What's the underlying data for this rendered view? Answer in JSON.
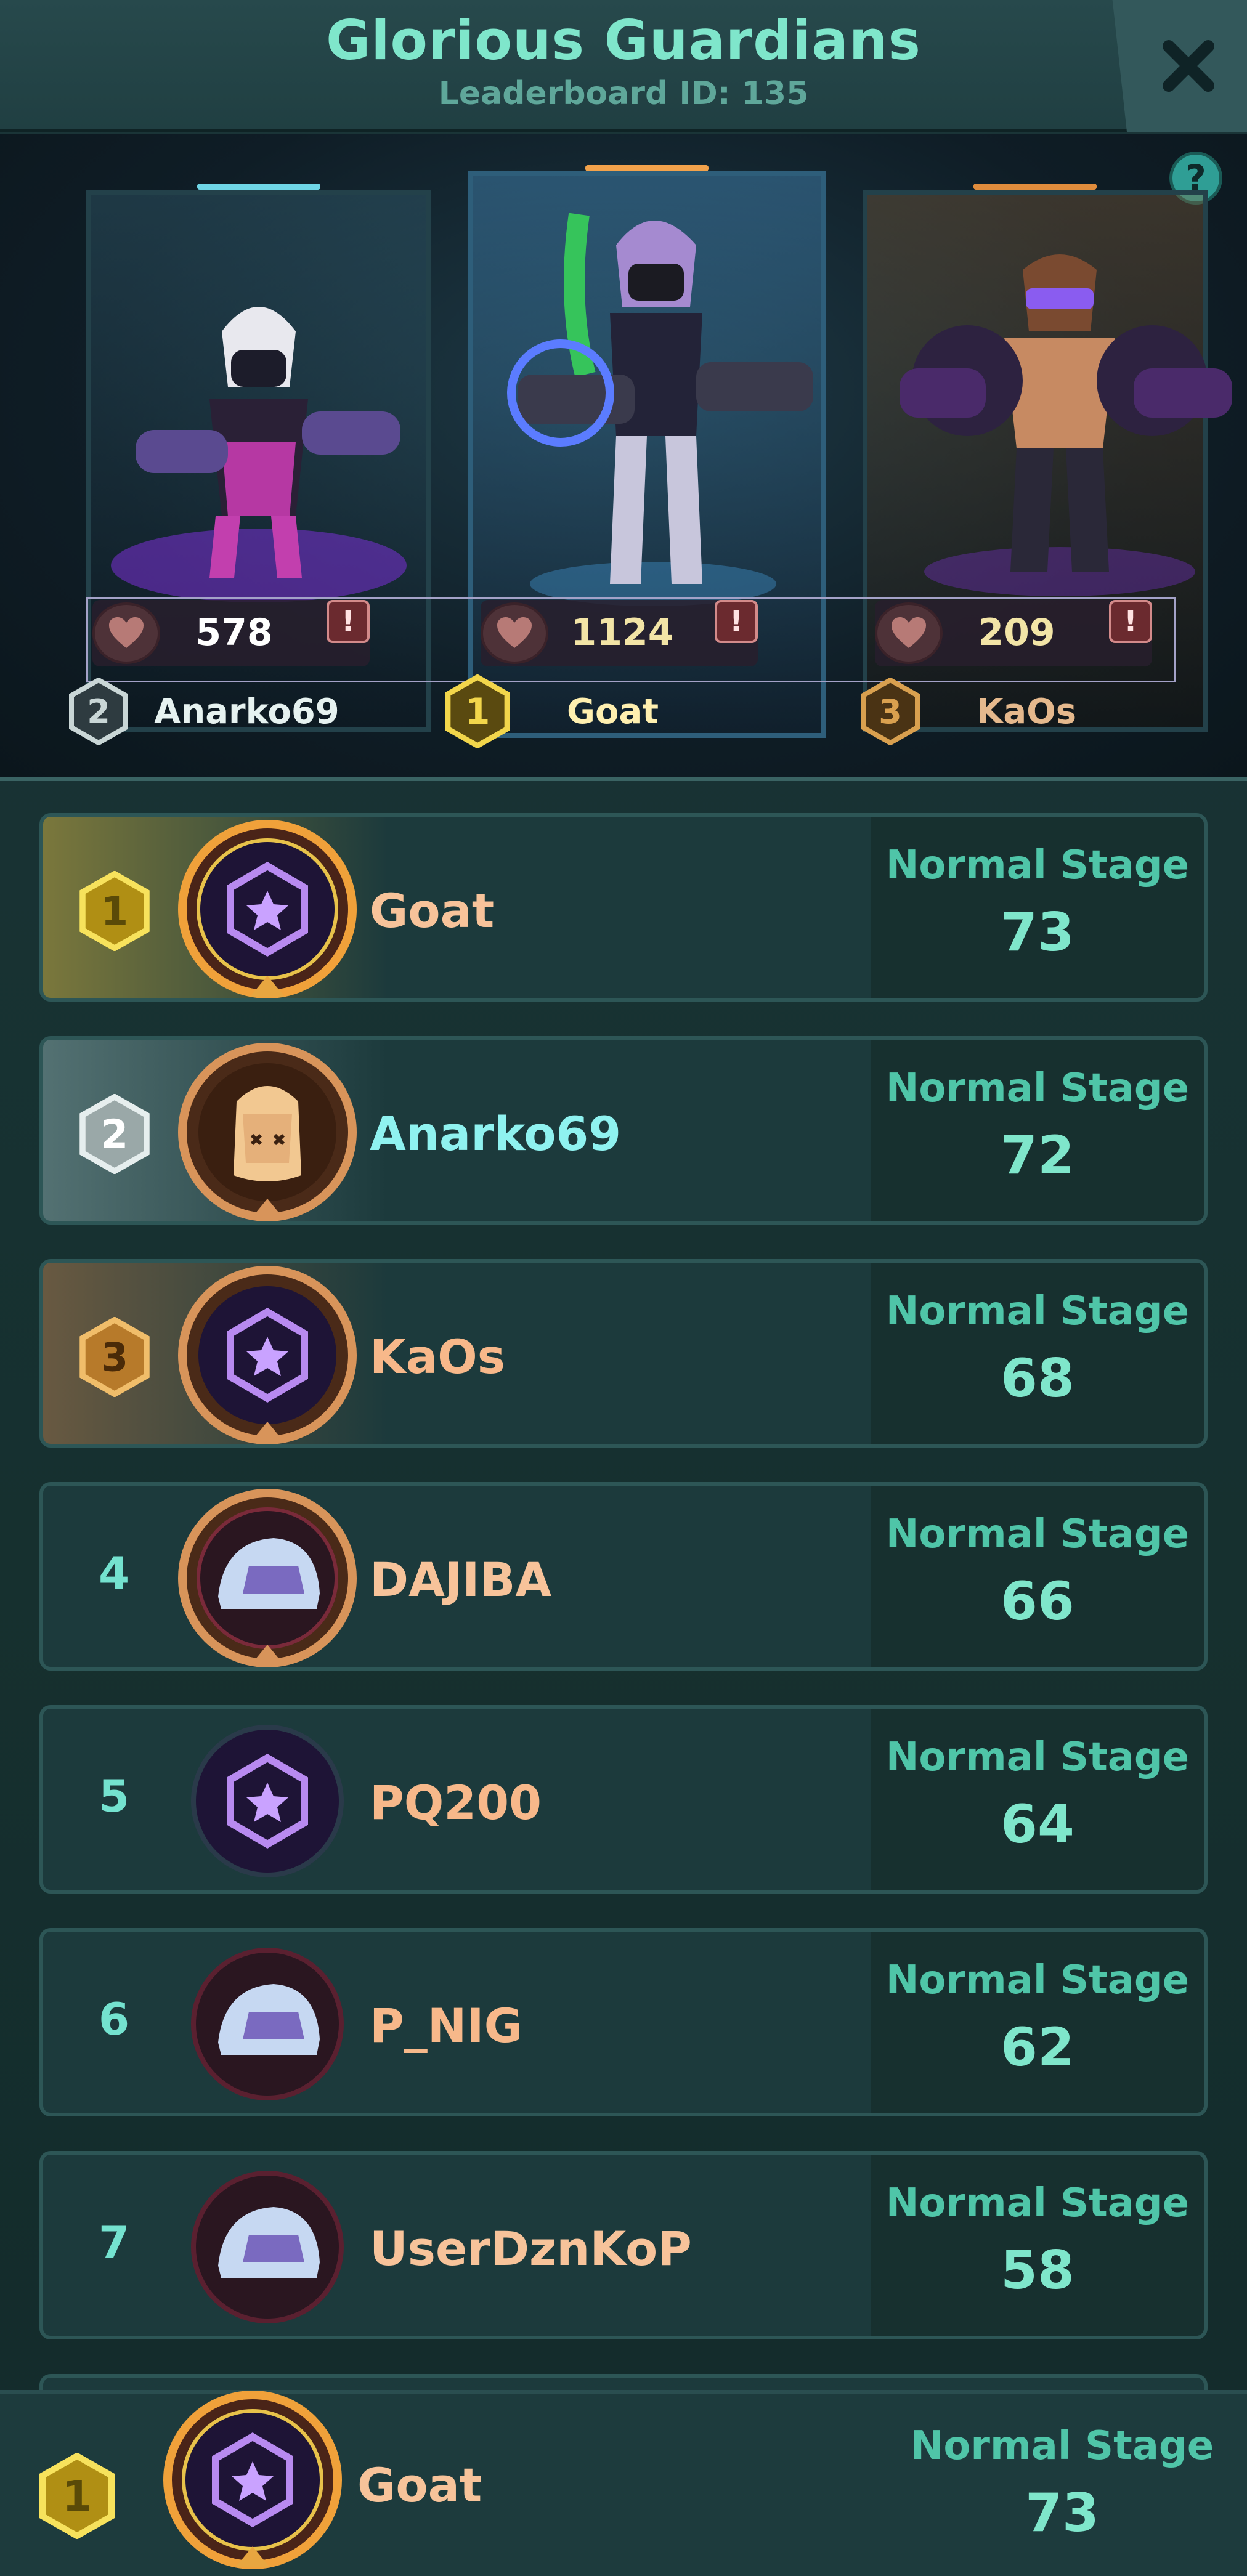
{
  "header": {
    "title": "Glorious Guardians",
    "subtitle": "Leaderboard ID: 135"
  },
  "icons": {
    "close": "close-icon",
    "help": "help-icon",
    "heart": "heart-icon",
    "report": "report-icon",
    "rank_badge": "rank-badge-icon"
  },
  "help_glyph": "?",
  "report_glyph": "!",
  "podium": [
    {
      "rank": "2",
      "name": "Anarko69",
      "likes": "578"
    },
    {
      "rank": "1",
      "name": "Goat",
      "likes": "1124"
    },
    {
      "rank": "3",
      "name": "KaOs",
      "likes": "209"
    }
  ],
  "rows": [
    {
      "rank": "1",
      "name": "Goat",
      "stage_label": "Normal Stage",
      "stage": "73",
      "avatar": "guardian-emblem"
    },
    {
      "rank": "2",
      "name": "Anarko69",
      "stage_label": "Normal Stage",
      "stage": "72",
      "avatar": "hero-portrait"
    },
    {
      "rank": "3",
      "name": "KaOs",
      "stage_label": "Normal Stage",
      "stage": "68",
      "avatar": "guardian-emblem"
    },
    {
      "rank": "4",
      "name": "DAJIBA",
      "stage_label": "Normal Stage",
      "stage": "66",
      "avatar": "helmet"
    },
    {
      "rank": "5",
      "name": "PQ200",
      "stage_label": "Normal Stage",
      "stage": "64",
      "avatar": "guardian-emblem"
    },
    {
      "rank": "6",
      "name": "P_NIG",
      "stage_label": "Normal Stage",
      "stage": "62",
      "avatar": "helmet"
    },
    {
      "rank": "7",
      "name": "UserDznKoP",
      "stage_label": "Normal Stage",
      "stage": "58",
      "avatar": "helmet"
    }
  ],
  "my_rank": {
    "rank": "1",
    "name": "Goat",
    "stage_label": "Normal Stage",
    "stage": "73"
  },
  "colors": {
    "accent": "#7fe6cb",
    "gold": "#f2d64b",
    "silver": "#c9d6d6",
    "bronze": "#d9a04f",
    "name_gradient": "#f7c39a"
  }
}
